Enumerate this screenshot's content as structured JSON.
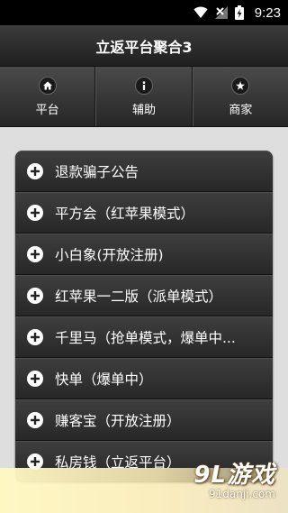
{
  "status_bar": {
    "time": "9:23"
  },
  "header": {
    "title": "立返平台聚合3"
  },
  "tabs": [
    {
      "label": "平台",
      "icon": "home-icon"
    },
    {
      "label": "辅助",
      "icon": "info-icon"
    },
    {
      "label": "商家",
      "icon": "star-icon"
    }
  ],
  "list": {
    "items": [
      {
        "label": "退款骗子公告"
      },
      {
        "label": "平方会（红苹果模式）"
      },
      {
        "label": "小白象(开放注册)"
      },
      {
        "label": "红苹果一二版（派单模式）"
      },
      {
        "label": "千里马（抢单模式，爆单中..."
      },
      {
        "label": "快单（爆单中）"
      },
      {
        "label": "赚客宝（开放注册）"
      },
      {
        "label": "私房钱（立返平台）"
      }
    ]
  },
  "watermark": {
    "logo": "9L游戏",
    "url": "91danji.com"
  },
  "colors": {
    "header_bg": "#2b2b2b",
    "page_bg": "#dedede",
    "item_text": "#ffffff"
  }
}
